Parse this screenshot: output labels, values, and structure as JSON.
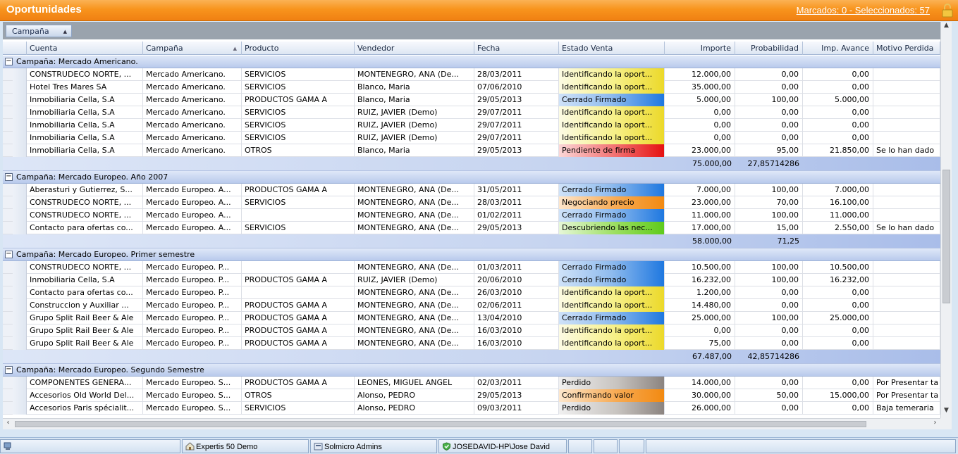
{
  "window": {
    "title": "Oportunidades",
    "marks_text": "Marcados: 0 - Seleccionados: 57"
  },
  "groupbar": {
    "chip_label": "Campaña"
  },
  "columns": [
    "Cuenta",
    "Campaña",
    "Producto",
    "Vendedor",
    "Fecha",
    "Estado Venta",
    "Importe",
    "Probabilidad",
    "Imp. Avance",
    "Motivo Perdida"
  ],
  "groups": [
    {
      "label": "Campaña:  Mercado Americano.",
      "rows": [
        {
          "cuenta": "CONSTRUDECO NORTE, ...",
          "campana": "Mercado Americano.",
          "producto": "SERVICIOS",
          "vendedor": "MONTENEGRO, ANA (De...",
          "fecha": "28/03/2011",
          "estado": "Identificando la oport...",
          "estado_color": "yellow",
          "importe": "12.000,00",
          "probabilidad": "0,00",
          "avance": "0,00",
          "motivo": ""
        },
        {
          "cuenta": "Hotel Tres Mares SA",
          "campana": "Mercado Americano.",
          "producto": "SERVICIOS",
          "vendedor": "Blanco, Maria",
          "fecha": "07/06/2010",
          "estado": "Identificando la oport...",
          "estado_color": "yellow",
          "importe": "35.000,00",
          "probabilidad": "0,00",
          "avance": "0,00",
          "motivo": ""
        },
        {
          "cuenta": "Inmobiliaria Cella, S.A",
          "campana": "Mercado Americano.",
          "producto": "PRODUCTOS GAMA A",
          "vendedor": "Blanco, Maria",
          "fecha": "29/05/2013",
          "estado": "Cerrado Firmado",
          "estado_color": "blue",
          "importe": "5.000,00",
          "probabilidad": "100,00",
          "avance": "5.000,00",
          "motivo": ""
        },
        {
          "cuenta": "Inmobiliaria Cella, S.A",
          "campana": "Mercado Americano.",
          "producto": "SERVICIOS",
          "vendedor": "RUIZ, JAVIER (Demo)",
          "fecha": "29/07/2011",
          "estado": "Identificando la oport...",
          "estado_color": "yellow",
          "importe": "0,00",
          "probabilidad": "0,00",
          "avance": "0,00",
          "motivo": ""
        },
        {
          "cuenta": "Inmobiliaria Cella, S.A",
          "campana": "Mercado Americano.",
          "producto": "SERVICIOS",
          "vendedor": "RUIZ, JAVIER (Demo)",
          "fecha": "29/07/2011",
          "estado": "Identificando la oport...",
          "estado_color": "yellow",
          "importe": "0,00",
          "probabilidad": "0,00",
          "avance": "0,00",
          "motivo": ""
        },
        {
          "cuenta": "Inmobiliaria Cella, S.A",
          "campana": "Mercado Americano.",
          "producto": "SERVICIOS",
          "vendedor": "RUIZ, JAVIER (Demo)",
          "fecha": "29/07/2011",
          "estado": "Identificando la oport...",
          "estado_color": "yellow",
          "importe": "0,00",
          "probabilidad": "0,00",
          "avance": "0,00",
          "motivo": ""
        },
        {
          "cuenta": "Inmobiliaria Cella, S.A",
          "campana": "Mercado Americano.",
          "producto": "OTROS",
          "vendedor": "Blanco, Maria",
          "fecha": "29/05/2013",
          "estado": "Pendiente de firma",
          "estado_color": "red",
          "importe": "23.000,00",
          "probabilidad": "95,00",
          "avance": "21.850,00",
          "motivo": "Se lo han dado"
        }
      ],
      "total_importe": "75.000,00",
      "total_prob": "27,85714286"
    },
    {
      "label": "Campaña:  Mercado Europeo. Año 2007",
      "rows": [
        {
          "cuenta": "Aberasturi y Gutierrez, S...",
          "campana": "Mercado Europeo. A...",
          "producto": "PRODUCTOS GAMA A",
          "vendedor": "MONTENEGRO, ANA (De...",
          "fecha": "31/05/2011",
          "estado": "Cerrado Firmado",
          "estado_color": "blue",
          "importe": "7.000,00",
          "probabilidad": "100,00",
          "avance": "7.000,00",
          "motivo": ""
        },
        {
          "cuenta": "CONSTRUDECO NORTE, ...",
          "campana": "Mercado Europeo. A...",
          "producto": "SERVICIOS",
          "vendedor": "MONTENEGRO, ANA (De...",
          "fecha": "28/03/2011",
          "estado": "Negociando precio",
          "estado_color": "orange",
          "importe": "23.000,00",
          "probabilidad": "70,00",
          "avance": "16.100,00",
          "motivo": ""
        },
        {
          "cuenta": "CONSTRUDECO NORTE, ...",
          "campana": "Mercado Europeo. A...",
          "producto": "",
          "vendedor": "MONTENEGRO, ANA (De...",
          "fecha": "01/02/2011",
          "estado": "Cerrado Firmado",
          "estado_color": "blue",
          "importe": "11.000,00",
          "probabilidad": "100,00",
          "avance": "11.000,00",
          "motivo": ""
        },
        {
          "cuenta": "Contacto para ofertas co...",
          "campana": "Mercado Europeo. A...",
          "producto": "SERVICIOS",
          "vendedor": "MONTENEGRO, ANA (De...",
          "fecha": "29/05/2013",
          "estado": "Descubriendo las nec...",
          "estado_color": "green",
          "importe": "17.000,00",
          "probabilidad": "15,00",
          "avance": "2.550,00",
          "motivo": "Se lo han dado"
        }
      ],
      "total_importe": "58.000,00",
      "total_prob": "71,25"
    },
    {
      "label": "Campaña:  Mercado Europeo. Primer semestre",
      "rows": [
        {
          "cuenta": "CONSTRUDECO NORTE, ...",
          "campana": "Mercado Europeo. P...",
          "producto": "",
          "vendedor": "MONTENEGRO, ANA (De...",
          "fecha": "01/03/2011",
          "estado": "Cerrado Firmado",
          "estado_color": "blue",
          "importe": "10.500,00",
          "probabilidad": "100,00",
          "avance": "10.500,00",
          "motivo": ""
        },
        {
          "cuenta": "Inmobiliaria Cella, S.A",
          "campana": "Mercado Europeo. P...",
          "producto": "PRODUCTOS GAMA A",
          "vendedor": "RUIZ, JAVIER (Demo)",
          "fecha": "20/06/2010",
          "estado": "Cerrado Firmado",
          "estado_color": "blue",
          "importe": "16.232,00",
          "probabilidad": "100,00",
          "avance": "16.232,00",
          "motivo": ""
        },
        {
          "cuenta": "Contacto para ofertas co...",
          "campana": "Mercado Europeo. P...",
          "producto": "",
          "vendedor": "MONTENEGRO, ANA (De...",
          "fecha": "26/03/2010",
          "estado": "Identificando la oport...",
          "estado_color": "yellow",
          "importe": "1.200,00",
          "probabilidad": "0,00",
          "avance": "0,00",
          "motivo": ""
        },
        {
          "cuenta": "Construccion y Auxiliar ...",
          "campana": "Mercado Europeo. P...",
          "producto": "PRODUCTOS GAMA A",
          "vendedor": "MONTENEGRO, ANA (De...",
          "fecha": "02/06/2011",
          "estado": "Identificando la oport...",
          "estado_color": "yellow",
          "importe": "14.480,00",
          "probabilidad": "0,00",
          "avance": "0,00",
          "motivo": ""
        },
        {
          "cuenta": "Grupo Split Rail Beer & Ale",
          "campana": "Mercado Europeo. P...",
          "producto": "PRODUCTOS GAMA A",
          "vendedor": "MONTENEGRO, ANA (De...",
          "fecha": "13/04/2010",
          "estado": "Cerrado Firmado",
          "estado_color": "blue",
          "importe": "25.000,00",
          "probabilidad": "100,00",
          "avance": "25.000,00",
          "motivo": ""
        },
        {
          "cuenta": "Grupo Split Rail Beer & Ale",
          "campana": "Mercado Europeo. P...",
          "producto": "PRODUCTOS GAMA A",
          "vendedor": "MONTENEGRO, ANA (De...",
          "fecha": "16/03/2010",
          "estado": "Identificando la oport...",
          "estado_color": "yellow",
          "importe": "0,00",
          "probabilidad": "0,00",
          "avance": "0,00",
          "motivo": ""
        },
        {
          "cuenta": "Grupo Split Rail Beer & Ale",
          "campana": "Mercado Europeo. P...",
          "producto": "PRODUCTOS GAMA A",
          "vendedor": "MONTENEGRO, ANA (De...",
          "fecha": "16/03/2010",
          "estado": "Identificando la oport...",
          "estado_color": "yellow",
          "importe": "75,00",
          "probabilidad": "0,00",
          "avance": "0,00",
          "motivo": ""
        }
      ],
      "total_importe": "67.487,00",
      "total_prob": "42,85714286"
    },
    {
      "label": "Campaña:  Mercado Europeo. Segundo Semestre",
      "rows": [
        {
          "cuenta": "COMPONENTES GENERA...",
          "campana": "Mercado Europeo. S...",
          "producto": "PRODUCTOS GAMA A",
          "vendedor": "LEONES, MIGUEL ANGEL",
          "fecha": "02/03/2011",
          "estado": "Perdido",
          "estado_color": "gray",
          "importe": "14.000,00",
          "probabilidad": "0,00",
          "avance": "0,00",
          "motivo": "Por Presentar ta"
        },
        {
          "cuenta": "Accesorios Old World Del...",
          "campana": "Mercado Europeo. S...",
          "producto": "OTROS",
          "vendedor": "Alonso, PEDRO",
          "fecha": "29/05/2013",
          "estado": "Confirmando valor",
          "estado_color": "orange",
          "importe": "30.000,00",
          "probabilidad": "50,00",
          "avance": "15.000,00",
          "motivo": "Por Presentar ta"
        },
        {
          "cuenta": "Accesorios Paris spécialit...",
          "campana": "Mercado Europeo. S...",
          "producto": "SERVICIOS",
          "vendedor": "Alonso, PEDRO",
          "fecha": "09/03/2011",
          "estado": "Perdido",
          "estado_color": "gray",
          "importe": "26.000,00",
          "probabilidad": "0,00",
          "avance": "0,00",
          "motivo": "Baja temeraria"
        }
      ]
    }
  ],
  "statusbar": {
    "db": "Expertis 50 Demo",
    "company": "Solmicro Admins",
    "user": "JOSEDAVID-HP\\Jose David"
  },
  "colors": {
    "title_orange": "#f8941d",
    "group_blue": "#b9caec",
    "status_blue": "#1f78e0",
    "status_yellow": "#ecd92a",
    "status_red": "#e51212",
    "status_orange": "#f28a12",
    "status_green": "#5fcb1c",
    "status_gray": "#8b8480"
  }
}
